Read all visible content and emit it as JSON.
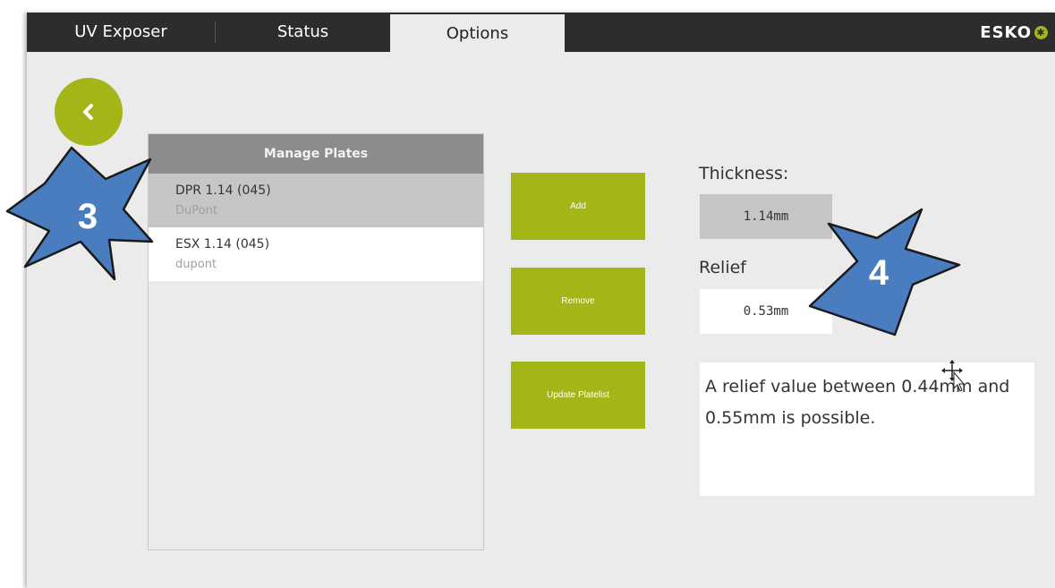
{
  "tabs": [
    {
      "label": "UV Exposer",
      "active": false
    },
    {
      "label": "Status",
      "active": false
    },
    {
      "label": "Options",
      "active": true
    }
  ],
  "brand": {
    "name": "ESKO"
  },
  "manage_plates": {
    "title": "Manage Plates",
    "plates": [
      {
        "name": "DPR 1.14 (045)",
        "vendor": "DuPont",
        "selected": true
      },
      {
        "name": "ESX 1.14 (045)",
        "vendor": "dupont",
        "selected": false
      }
    ]
  },
  "actions": {
    "add_label": "Add",
    "remove_label": "Remove",
    "update_label": "Update Platelist"
  },
  "thickness": {
    "label": "Thickness:",
    "value": "1.14mm"
  },
  "relief": {
    "label": "Relief",
    "value": "0.53mm"
  },
  "info": {
    "text": "A relief value between 0.44mm and 0.55mm is possible."
  },
  "annotations": [
    {
      "number": "3"
    },
    {
      "number": "4"
    }
  ],
  "colors": {
    "accent": "#a3b517",
    "topbar": "#2d2d2d",
    "background": "#ebebeb",
    "callout_arrow": "#4a7dc0"
  }
}
